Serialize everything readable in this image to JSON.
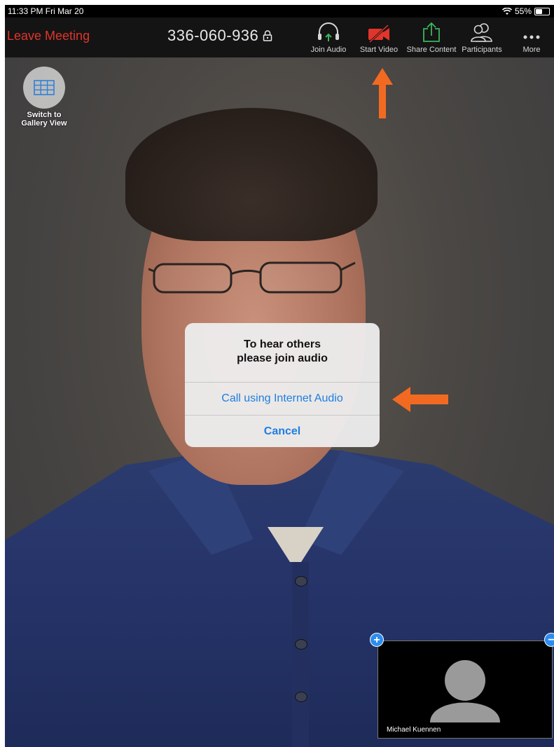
{
  "status_bar": {
    "time": "11:33 PM  Fri Mar 20",
    "battery": "55%",
    "battery_level": 0.55
  },
  "toolbar": {
    "leave_label": "Leave Meeting",
    "meeting_id": "336-060-936",
    "buttons": [
      {
        "label": "Join Audio",
        "icon": "headphones-icon"
      },
      {
        "label": "Start Video",
        "icon": "video-off-icon"
      },
      {
        "label": "Share Content",
        "icon": "share-icon"
      },
      {
        "label": "Participants",
        "icon": "participants-icon"
      },
      {
        "label": "More",
        "icon": "more-icon"
      }
    ]
  },
  "gallery": {
    "label_line1": "Switch to",
    "label_line2": "Gallery View"
  },
  "dialog": {
    "title_line1": "To hear others",
    "title_line2": "please join audio",
    "primary_action": "Call using Internet Audio",
    "cancel": "Cancel"
  },
  "self_view": {
    "name": "Michael Kuennen",
    "expand_icon": "+",
    "collapse_icon": "−"
  },
  "colors": {
    "leave": "#e0352b",
    "video_off": "#e0352b",
    "share": "#3cb55a",
    "dialog_action": "#1e7ee0",
    "annotation_arrow": "#f26a21"
  }
}
